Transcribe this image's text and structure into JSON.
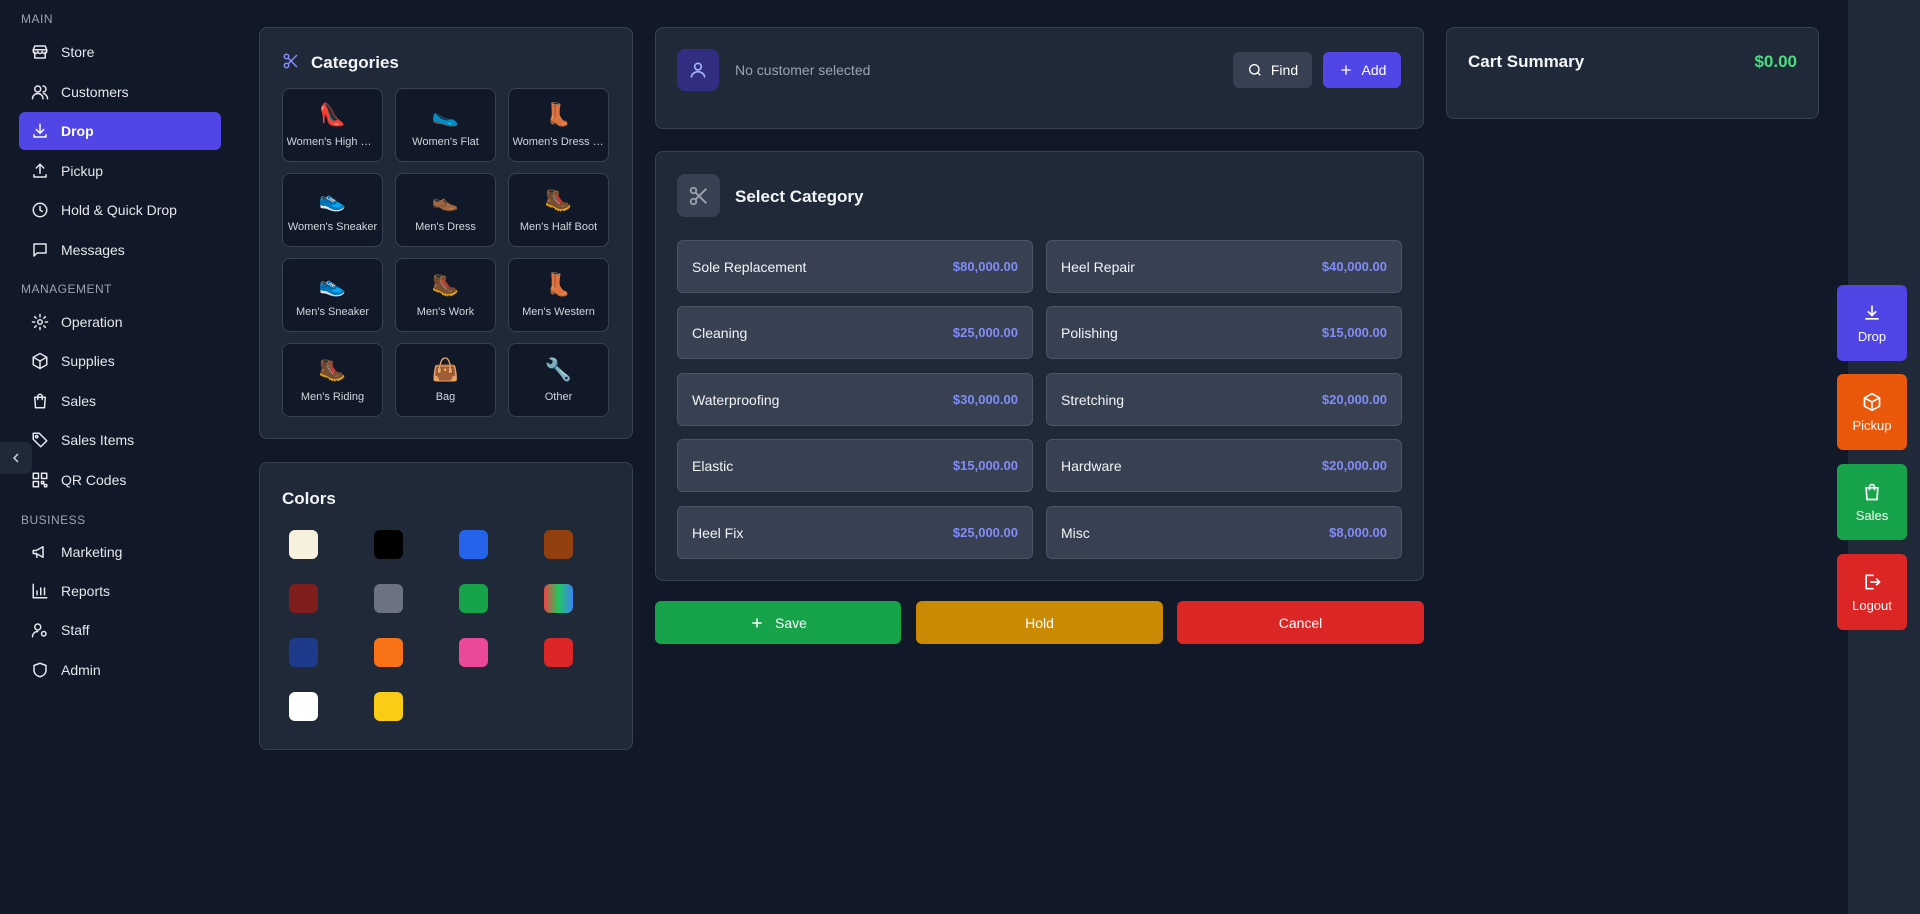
{
  "sidebar": {
    "sections": {
      "main": "MAIN",
      "management": "MANAGEMENT",
      "business": "BUSINESS"
    },
    "items": [
      {
        "label": "Store",
        "icon": "store-icon"
      },
      {
        "label": "Customers",
        "icon": "users-icon"
      },
      {
        "label": "Drop",
        "icon": "download-icon",
        "active": true
      },
      {
        "label": "Pickup",
        "icon": "upload-icon"
      },
      {
        "label": "Hold & Quick Drop",
        "icon": "clock-icon"
      },
      {
        "label": "Messages",
        "icon": "message-icon"
      },
      {
        "label": "Operation",
        "icon": "gear-icon"
      },
      {
        "label": "Supplies",
        "icon": "box-icon"
      },
      {
        "label": "Sales",
        "icon": "shopping-bag-icon"
      },
      {
        "label": "Sales Items",
        "icon": "tag-icon"
      },
      {
        "label": "QR Codes",
        "icon": "qr-code-icon"
      },
      {
        "label": "Marketing",
        "icon": "megaphone-icon"
      },
      {
        "label": "Reports",
        "icon": "bar-chart-icon"
      },
      {
        "label": "Staff",
        "icon": "user-gear-icon"
      },
      {
        "label": "Admin",
        "icon": "shield-icon"
      }
    ]
  },
  "categories": {
    "title": "Categories",
    "items": [
      {
        "label": "Women's High Heel",
        "emoji": "👠"
      },
      {
        "label": "Women's Flat",
        "emoji": "🥿"
      },
      {
        "label": "Women's Dress Boot",
        "emoji": "👢"
      },
      {
        "label": "Women's Sneaker",
        "emoji": "👟"
      },
      {
        "label": "Men's Dress",
        "emoji": "👞"
      },
      {
        "label": "Men's Half Boot",
        "emoji": "🥾"
      },
      {
        "label": "Men's Sneaker",
        "emoji": "👟"
      },
      {
        "label": "Men's Work",
        "emoji": "🥾"
      },
      {
        "label": "Men's Western",
        "emoji": "👢"
      },
      {
        "label": "Men's Riding",
        "emoji": "🥾"
      },
      {
        "label": "Bag",
        "emoji": "👜"
      },
      {
        "label": "Other",
        "emoji": "🔧"
      }
    ]
  },
  "colors": {
    "title": "Colors",
    "swatches": [
      "#f5f1dc",
      "#000000",
      "#2563eb",
      "#92400e",
      "#7f1d1d",
      "#6b7280",
      "#16a34a",
      "multicolor",
      "#1e3a8a",
      "#f97316",
      "#ec4899",
      "#dc2626",
      "#ffffff",
      "#facc15"
    ]
  },
  "customer": {
    "placeholder": "No customer selected",
    "find_label": "Find",
    "add_label": "Add"
  },
  "service": {
    "title": "Select Category",
    "items": [
      {
        "name": "Sole Replacement",
        "price": "$80,000.00"
      },
      {
        "name": "Heel Repair",
        "price": "$40,000.00"
      },
      {
        "name": "Cleaning",
        "price": "$25,000.00"
      },
      {
        "name": "Polishing",
        "price": "$15,000.00"
      },
      {
        "name": "Waterproofing",
        "price": "$30,000.00"
      },
      {
        "name": "Stretching",
        "price": "$20,000.00"
      },
      {
        "name": "Elastic",
        "price": "$15,000.00"
      },
      {
        "name": "Hardware",
        "price": "$20,000.00"
      },
      {
        "name": "Heel Fix",
        "price": "$25,000.00"
      },
      {
        "name": "Misc",
        "price": "$8,000.00"
      }
    ]
  },
  "actions": {
    "save": "Save",
    "hold": "Hold",
    "cancel": "Cancel"
  },
  "cart": {
    "title": "Cart Summary",
    "total": "$0.00"
  },
  "dock": {
    "drop": "Drop",
    "pickup": "Pickup",
    "sales": "Sales",
    "logout": "Logout"
  },
  "theme": {
    "accent": "#4f46e5",
    "save": "#16a34a",
    "hold": "#ca8a04",
    "cancel": "#dc2626",
    "pickup": "#ea580c",
    "price": "#818cf8",
    "total": "#4ade80"
  }
}
